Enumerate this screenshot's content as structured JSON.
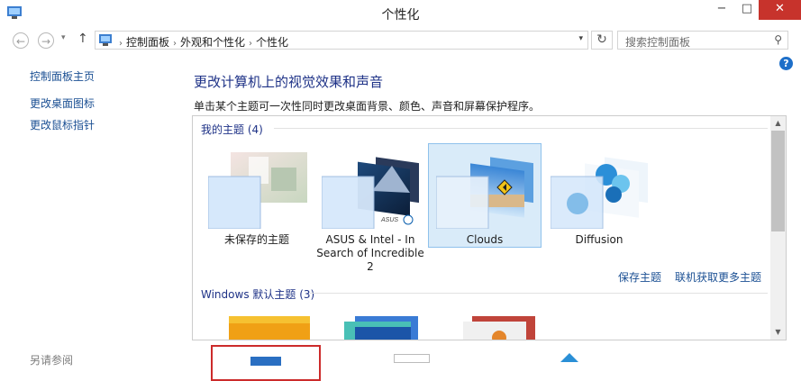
{
  "window": {
    "title": "个性化",
    "minimize": "−",
    "maximize": "□",
    "close": "✕"
  },
  "nav": {
    "back_icon": "arrow-left-icon",
    "forward_icon": "arrow-right-icon",
    "up_icon": "arrow-up-icon",
    "breadcrumb": [
      "控制面板",
      "外观和个性化",
      "个性化"
    ],
    "search_placeholder": "搜索控制面板"
  },
  "sidebar": {
    "items": [
      "控制面板主页",
      "更改桌面图标",
      "更改鼠标指针"
    ],
    "see_also": "另请参阅"
  },
  "main": {
    "title": "更改计算机上的视觉效果和声音",
    "description": "单击某个主题可一次性同时更改桌面背景、颜色、声音和屏幕保护程序。",
    "my_themes_header": "我的主题 (4)",
    "themes": [
      {
        "label": "未保存的主题",
        "selected": false
      },
      {
        "label": "ASUS & Intel - In Search of Incredible 2",
        "selected": false,
        "brand_text": "ASUS"
      },
      {
        "label": "Clouds",
        "selected": true
      },
      {
        "label": "Diffusion",
        "selected": false
      }
    ],
    "save_theme_link": "保存主题",
    "get_more_link": "联机获取更多主题",
    "windows_themes_header": "Windows 默认主题 (3)"
  },
  "colors": {
    "accent": "#1e3287",
    "link": "#1a4f93",
    "close_button": "#c7332c",
    "selection": "#d9ebf9",
    "highlight_box": "#cc2b2b"
  }
}
